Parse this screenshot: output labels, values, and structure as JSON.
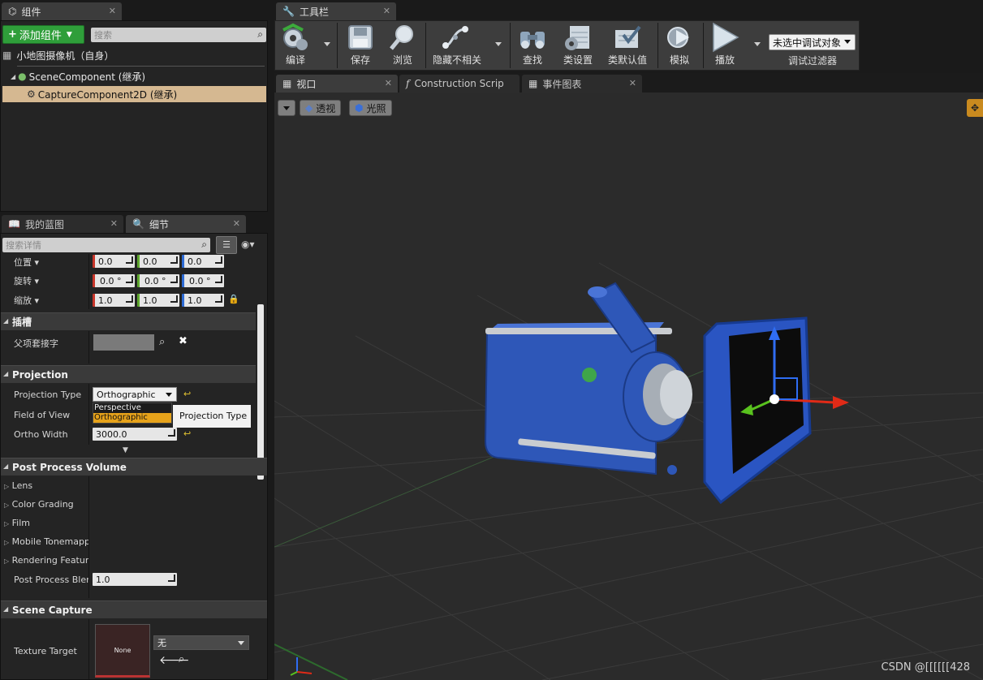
{
  "components_panel": {
    "tab_label": "组件",
    "add_button_label": "添加组件",
    "search_placeholder": "搜索",
    "root_label": "小地图摄像机（自身）",
    "tree": [
      {
        "label": "SceneComponent (继承)",
        "selected": false
      },
      {
        "label": "CaptureComponent2D (继承)",
        "selected": true
      }
    ]
  },
  "lower_tabs": {
    "my_blueprint": "我的蓝图",
    "details": "细节"
  },
  "details": {
    "search_placeholder": "搜索详情",
    "transform": [
      {
        "label": "位置",
        "values": [
          "0.0",
          "0.0",
          "0.0"
        ]
      },
      {
        "label": "旋转",
        "values": [
          "0.0 °",
          "0.0 °",
          "0.0 °"
        ]
      },
      {
        "label": "缩放",
        "values": [
          "1.0",
          "1.0",
          "1.0"
        ]
      }
    ],
    "socket_section": "插槽",
    "parent_socket_label": "父项套接字",
    "projection_section": "Projection",
    "projection_type_label": "Projection Type",
    "projection_type_value": "Orthographic",
    "projection_options": [
      "Perspective",
      "Orthographic"
    ],
    "tooltip": "Projection Type",
    "fov_label": "Field of View",
    "ortho_width_label": "Ortho Width",
    "ortho_width_value": "3000.0",
    "post_process_section": "Post Process Volume",
    "post_process_items": [
      "Lens",
      "Color Grading",
      "Film",
      "Mobile Tonemapp",
      "Rendering Feature"
    ],
    "post_process_blend_label": "Post Process Blen",
    "post_process_blend_value": "1.0",
    "scene_capture_section": "Scene Capture",
    "texture_target_label": "Texture Target",
    "texture_thumb_text": "None",
    "texture_value": "无"
  },
  "toolbar": {
    "tab_label": "工具栏",
    "buttons": {
      "compile": "编译",
      "save": "保存",
      "browse": "浏览",
      "hide": "隐藏不相关",
      "find": "查找",
      "class_settings": "类设置",
      "class_defaults": "类默认值",
      "simulate": "模拟",
      "play": "播放"
    },
    "debug_object": "未选中调试对象",
    "debug_filter": "调试过滤器"
  },
  "editor_tabs": [
    {
      "label": "视口",
      "icon": "grid-icon"
    },
    {
      "label": "Construction Scrip",
      "icon": "function-icon"
    },
    {
      "label": "事件图表",
      "icon": "graph-icon"
    }
  ],
  "viewport": {
    "perspective_label": "透视",
    "lighting_label": "光照"
  },
  "watermark": "CSDN @[[[[[[428"
}
